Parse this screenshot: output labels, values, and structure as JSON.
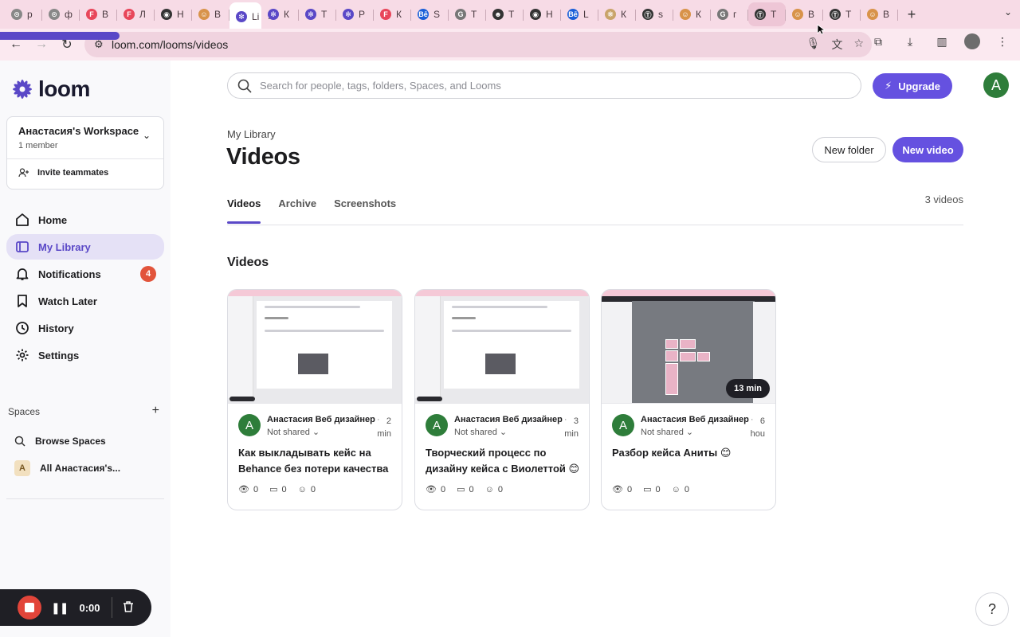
{
  "browser": {
    "tabs": [
      {
        "letter": "р",
        "color": "#888888",
        "glyph": "⊙"
      },
      {
        "letter": "ф",
        "color": "#888888",
        "glyph": "⊙"
      },
      {
        "letter": "В",
        "color": "#e8465a",
        "glyph": "F"
      },
      {
        "letter": "Л",
        "color": "#e8465a",
        "glyph": "F"
      },
      {
        "letter": "Н",
        "color": "#333333",
        "glyph": "◉"
      },
      {
        "letter": "В",
        "color": "#d8934a",
        "glyph": "☺"
      },
      {
        "letter": "Li",
        "color": "#5a48c7",
        "glyph": "✻"
      },
      {
        "letter": "К",
        "color": "#5a48c7",
        "glyph": "✻"
      },
      {
        "letter": "Т",
        "color": "#5a48c7",
        "glyph": "✻"
      },
      {
        "letter": "Р",
        "color": "#5a48c7",
        "glyph": "✻"
      },
      {
        "letter": "К",
        "color": "#e8465a",
        "glyph": "F"
      },
      {
        "letter": "S",
        "color": "#1a5fd8",
        "glyph": "Bē"
      },
      {
        "letter": "Т",
        "color": "#777777",
        "glyph": "G"
      },
      {
        "letter": "Т",
        "color": "#333333",
        "glyph": "☻"
      },
      {
        "letter": "Н",
        "color": "#333333",
        "glyph": "◉"
      },
      {
        "letter": "L",
        "color": "#1a5fd8",
        "glyph": "Bē"
      },
      {
        "letter": "К",
        "color": "#c9a46a",
        "glyph": "❋"
      },
      {
        "letter": "s",
        "color": "#333333",
        "glyph": "Ⓣ"
      },
      {
        "letter": "К",
        "color": "#d8934a",
        "glyph": "☺"
      },
      {
        "letter": "г",
        "color": "#777777",
        "glyph": "G"
      },
      {
        "letter": "Т",
        "color": "#333333",
        "glyph": "Ⓣ"
      },
      {
        "letter": "В",
        "color": "#d8934a",
        "glyph": "☺"
      },
      {
        "letter": "Т",
        "color": "#333333",
        "glyph": "Ⓣ"
      },
      {
        "letter": "В",
        "color": "#d8934a",
        "glyph": "☺"
      }
    ],
    "active_tab_index": 6,
    "url": "loom.com/looms/videos"
  },
  "sidebar": {
    "logo_text": "loom",
    "workspace_name": "Анастасия's Workspace",
    "workspace_members": "1 member",
    "invite_label": "Invite teammates",
    "nav": [
      {
        "label": "Home",
        "icon": "home-icon"
      },
      {
        "label": "My Library",
        "icon": "library-icon",
        "active": true
      },
      {
        "label": "Notifications",
        "icon": "bell-icon",
        "badge": "4"
      },
      {
        "label": "Watch Later",
        "icon": "bookmark-icon"
      },
      {
        "label": "History",
        "icon": "clock-icon"
      },
      {
        "label": "Settings",
        "icon": "gear-icon"
      }
    ],
    "spaces_label": "Spaces",
    "browse_spaces": "Browse Spaces",
    "all_space_avatar": "A",
    "all_space_label": "All Анастасия's..."
  },
  "recorder": {
    "time": "0:00"
  },
  "header": {
    "search_placeholder": "Search for people, tags, folders, Spaces, and Looms",
    "upgrade_label": "Upgrade",
    "user_initial": "A"
  },
  "page": {
    "breadcrumb": "My Library",
    "title": "Videos",
    "new_folder": "New folder",
    "new_video": "New video",
    "tabs": [
      "Videos",
      "Archive",
      "Screenshots"
    ],
    "active_tab": "Videos",
    "video_count": "3 videos",
    "section_title": "Videos"
  },
  "videos": [
    {
      "author_initial": "A",
      "author": "Анастасия Веб дизайнер",
      "age_num": "2",
      "age_unit": "min",
      "sharing": "Not shared",
      "title": "Как выкладывать кейс на Behance без потери качества",
      "views": "0",
      "comments": "0",
      "reactions": "0",
      "duration": ""
    },
    {
      "author_initial": "A",
      "author": "Анастасия Веб дизайнер",
      "age_num": "3",
      "age_unit": "min",
      "sharing": "Not shared",
      "title": "Творческий процесс по дизайну кейса с Виолеттой 😊",
      "views": "0",
      "comments": "0",
      "reactions": "0",
      "duration": ""
    },
    {
      "author_initial": "A",
      "author": "Анастасия Веб дизайнер",
      "age_num": "6",
      "age_unit": "hou",
      "sharing": "Not shared",
      "title": "Разбор кейса Аниты 😊",
      "views": "0",
      "comments": "0",
      "reactions": "0",
      "duration": "13 min"
    }
  ],
  "help_label": "?"
}
